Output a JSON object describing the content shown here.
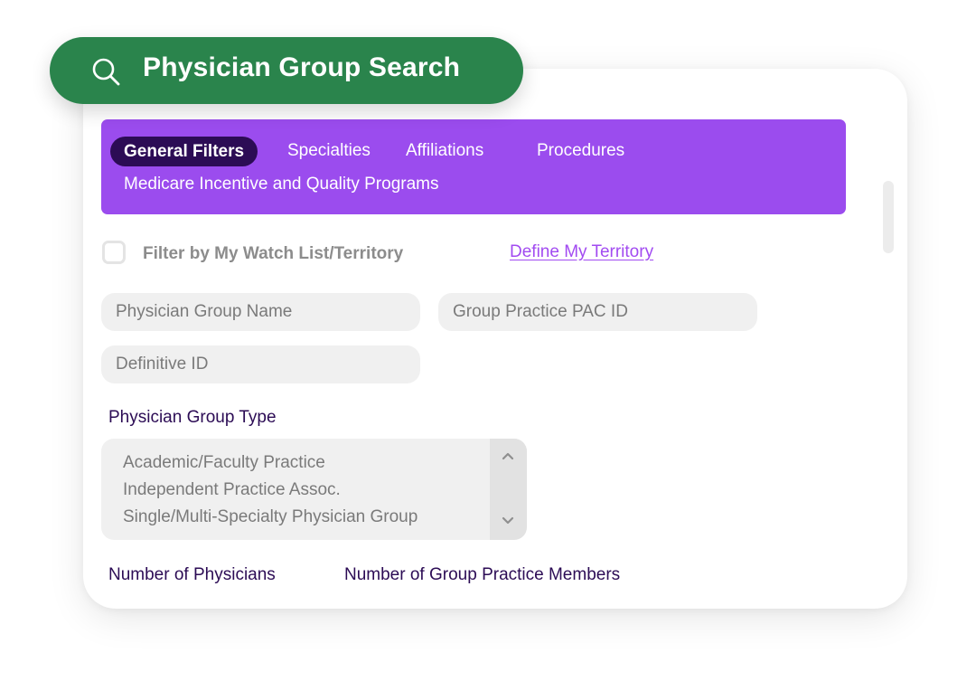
{
  "header": {
    "title": "Physician Group Search",
    "icon": "search-icon"
  },
  "tabs": [
    {
      "label": "General Filters",
      "active": true
    },
    {
      "label": "Specialties",
      "active": false
    },
    {
      "label": "Affiliations",
      "active": false
    },
    {
      "label": "Procedures",
      "active": false
    },
    {
      "label": "Medicare Incentive and Quality Programs",
      "active": false
    }
  ],
  "filters": {
    "watchlist_label": "Filter by My Watch List/Territory",
    "watchlist_checked": false,
    "define_territory_link": "Define My Territory"
  },
  "fields": {
    "group_name_placeholder": "Physician Group Name",
    "pac_id_placeholder": "Group Practice PAC ID",
    "definitive_id_placeholder": "Definitive ID"
  },
  "group_type": {
    "label": "Physician Group Type",
    "options": [
      "Academic/Faculty Practice",
      "Independent Practice Assoc.",
      "Single/Multi-Specialty Physician Group"
    ]
  },
  "sections": {
    "num_physicians_label": "Number of Physicians",
    "num_members_label": "Number of Group Practice Members"
  },
  "colors": {
    "header_green": "#2a844c",
    "tabbar_purple": "#9b4cee",
    "active_tab": "#2c0c55",
    "link_purple": "#a24bf1",
    "label_dark": "#2c0c55"
  }
}
